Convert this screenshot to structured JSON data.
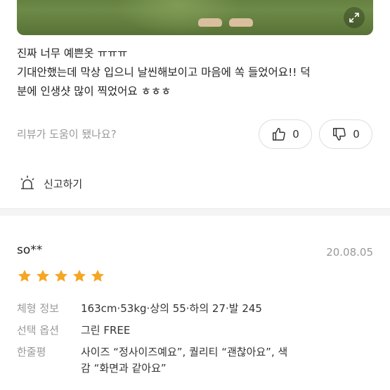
{
  "review1": {
    "image_icon": "expand-icon",
    "lines": [
      "진짜 너무 예쁜옷 ㅠㅠㅠ",
      "기대안했는데 막상 입으니 날씬해보이고 마음에 쏙 들었어요!! 덕",
      "분에 인생샷 많이 찍었어요 ㅎㅎㅎ"
    ],
    "helpful_question": "리뷰가 도움이 됐나요?",
    "like_count": "0",
    "dislike_count": "0",
    "report_label": "신고하기"
  },
  "review2": {
    "username": "so**",
    "date": "20.08.05",
    "rating": 5,
    "star_color": "#f5a623",
    "body_info": {
      "label": "체형 정보",
      "value": "163cm·53kg·상의 55·하의 27·발 245"
    },
    "option": {
      "label": "선택 옵션",
      "value": "그린 FREE"
    },
    "summary": {
      "label": "한줄평",
      "value": "사이즈 “정사이즈예요”, 퀄리티 “괜찮아요”, 색감 “화면과 같아요”"
    }
  }
}
